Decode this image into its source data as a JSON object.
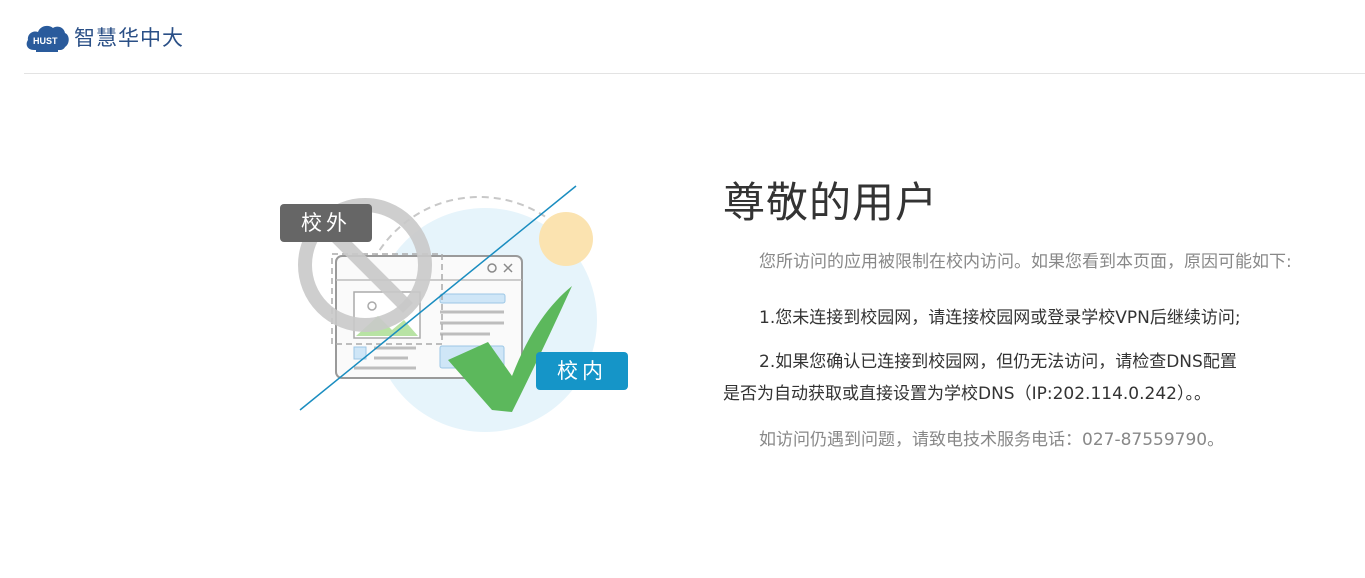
{
  "header": {
    "logo_badge": "HUST",
    "logo_text": "智慧华中大"
  },
  "illustration": {
    "tag_outside": "校外",
    "tag_inside": "校内"
  },
  "content": {
    "title": "尊敬的用户",
    "intro": "您所访问的应用被限制在校内访问。如果您看到本页面，原因可能如下:",
    "reasons": [
      "1.您未连接到校园网，请连接校园网或登录学校VPN后继续访问;",
      "2.如果您确认已连接到校园网，但仍无法访问，请检查DNS配置是否为自动获取或直接设置为学校DNS（IP:202.114.0.242）。。"
    ],
    "contact": "如访问仍遇到问题，请致电技术服务电话：027-87559790。"
  },
  "colors": {
    "brand_blue": "#2a4f86",
    "tag_outside_bg": "#666666",
    "tag_inside_bg": "#1595c8",
    "check_green": "#5cb85c"
  }
}
